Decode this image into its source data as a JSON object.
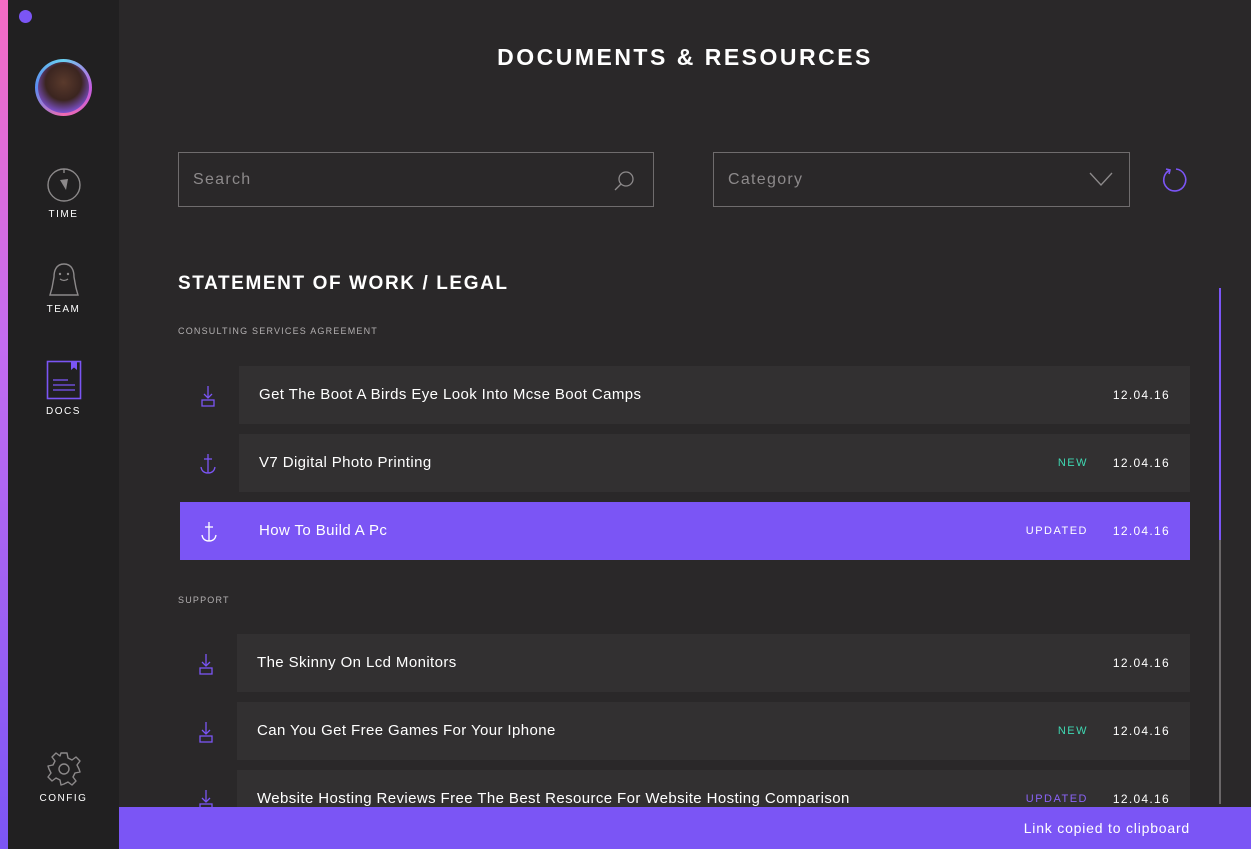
{
  "colors": {
    "accent": "#7b55f5",
    "new_badge": "#3fd8b2",
    "sidebar_bg": "#212021",
    "main_bg": "#2a2829",
    "row_bg": "#323031"
  },
  "sidebar": {
    "items": [
      {
        "label": "TIME",
        "icon": "timer-icon"
      },
      {
        "label": "TEAM",
        "icon": "person-icon"
      },
      {
        "label": "DOCS",
        "icon": "document-icon",
        "active": true
      },
      {
        "label": "CONFIG",
        "icon": "gear-icon"
      }
    ]
  },
  "header": {
    "title": "DOCUMENTS & RESOURCES"
  },
  "filters": {
    "search_placeholder": "Search",
    "category_value": "Category"
  },
  "section": {
    "title": "STATEMENT OF WORK / LEGAL",
    "groups": [
      {
        "heading": "CONSULTING SERVICES AGREEMENT",
        "rows": [
          {
            "title": "Get The Boot A Birds Eye Look Into Mcse Boot Camps",
            "badge": "",
            "date": "12.04.16",
            "icon": "download-icon"
          },
          {
            "title": "V7 Digital Photo Printing",
            "badge": "NEW",
            "date": "12.04.16",
            "icon": "anchor-icon"
          },
          {
            "title": "How To Build A Pc",
            "badge": "UPDATED",
            "date": "12.04.16",
            "icon": "anchor-icon",
            "selected": true
          }
        ]
      },
      {
        "heading": "SUPPORT",
        "rows": [
          {
            "title": "The Skinny On Lcd Monitors",
            "badge": "",
            "date": "12.04.16",
            "icon": "download-icon"
          },
          {
            "title": "Can You Get Free Games For Your Iphone",
            "badge": "NEW",
            "date": "12.04.16",
            "icon": "download-icon"
          },
          {
            "title": "Website Hosting Reviews Free The Best Resource For Website Hosting Comparison",
            "badge": "UPDATED",
            "date": "12.04.16",
            "icon": "download-icon"
          }
        ]
      }
    ]
  },
  "toast": {
    "message": "Link copied to clipboard"
  }
}
